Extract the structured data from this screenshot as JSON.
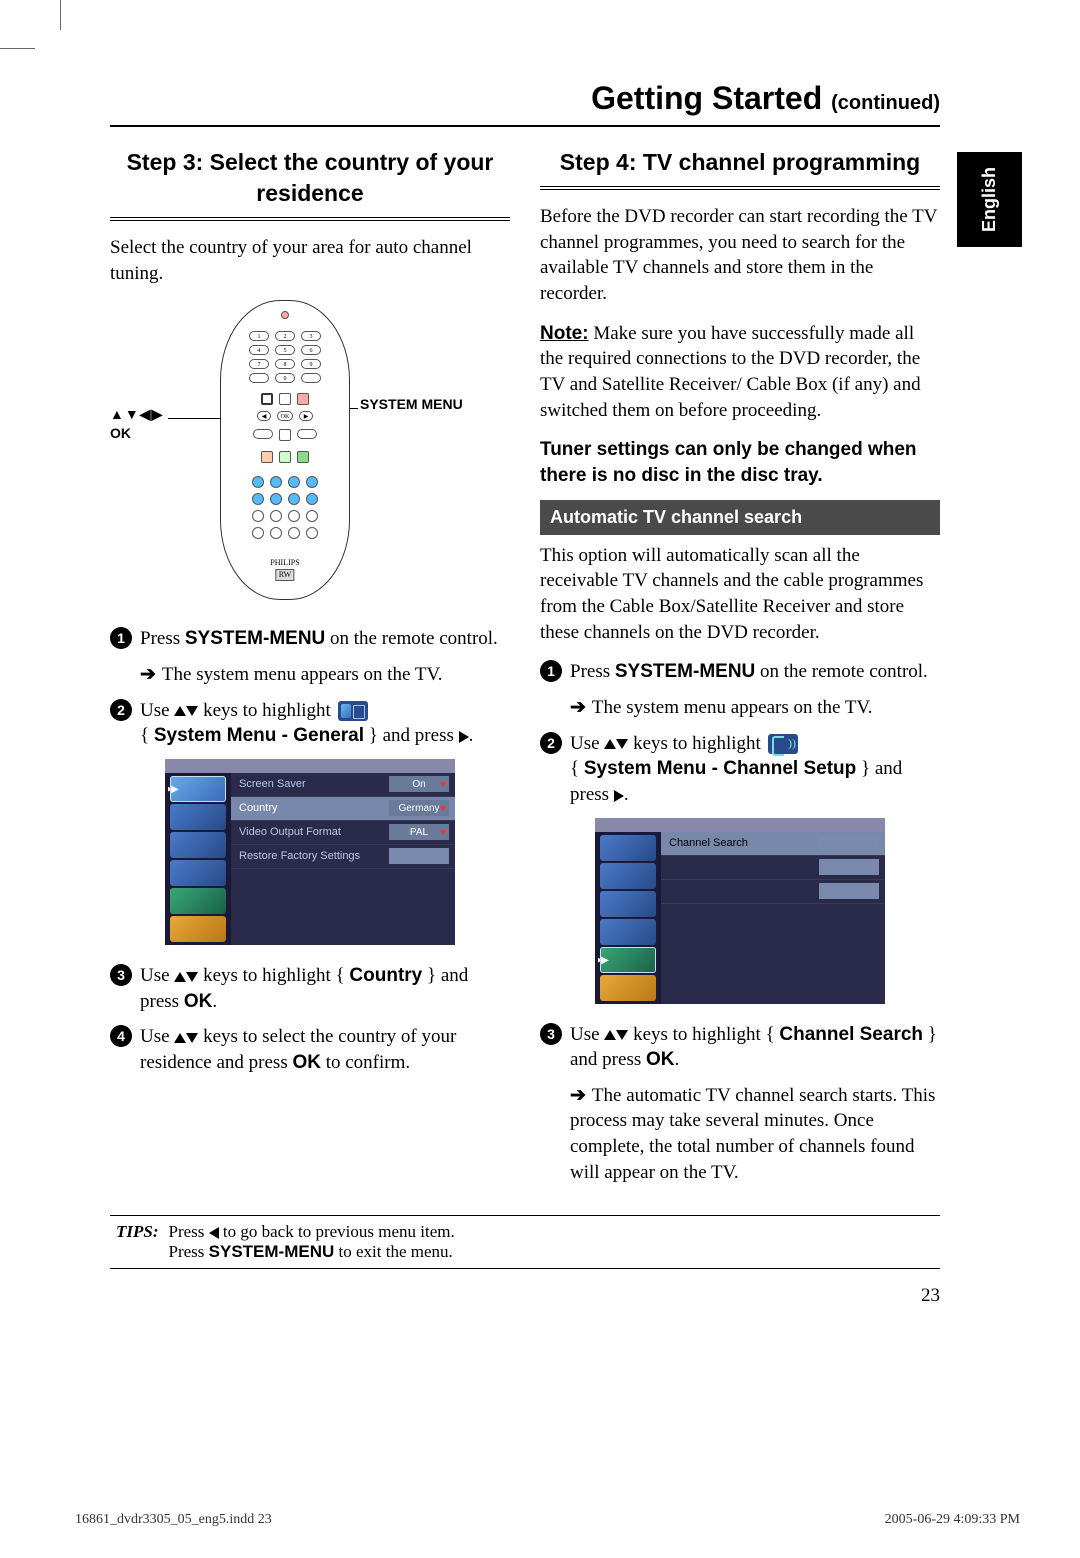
{
  "title_main": "Getting Started",
  "title_suffix": "(continued)",
  "lang_tab": "English",
  "left": {
    "step_heading": "Step 3:  Select the country of your residence",
    "intro": "Select the country of your area for auto channel tuning.",
    "remote_label_arrows": "▲▼◀▶",
    "remote_label_ok": "OK",
    "remote_label_right": "SYSTEM MENU",
    "remote_brand": "PHILIPS",
    "s1_a": "Press ",
    "s1_b": "SYSTEM-MENU",
    "s1_c": " on the remote control.",
    "s1_sub": "The system menu appears on the TV.",
    "s2_a": "Use ",
    "s2_b": " keys to highlight ",
    "s2_c": "System Menu - General",
    "s2_d": " } and press ",
    "menu": {
      "rows": [
        {
          "label": "Screen Saver",
          "val": "On"
        },
        {
          "label": "Country",
          "val": "Germany",
          "sel": true
        },
        {
          "label": "Video Output Format",
          "val": "PAL"
        },
        {
          "label": "Restore Factory Settings",
          "val": "",
          "empty": true
        }
      ]
    },
    "s3_a": "Use ",
    "s3_b": " keys to highlight { ",
    "s3_c": "Country",
    "s3_d": " } and press ",
    "s3_e": "OK",
    "s4_a": "Use ",
    "s4_b": " keys to select the country of your residence and press ",
    "s4_c": "OK",
    "s4_d": " to confirm."
  },
  "right": {
    "step_heading": "Step 4:  TV channel programming",
    "p1": "Before the DVD recorder can start recording the TV channel programmes, you need to search for the available TV channels and store them in the recorder.",
    "note_b": "Note:",
    "note_t": " Make sure you have successfully made all the required connections to the DVD recorder, the TV and Satellite Receiver/ Cable Box (if any) and switched them on before proceeding.",
    "bold_note": "Tuner settings can only be changed when there is no disc in the disc tray.",
    "section_bar": "Automatic TV channel search",
    "p2": "This option will automatically scan all the receivable TV channels and the cable programmes from the Cable Box/Satellite Receiver and store these channels on the DVD recorder.",
    "s1_a": "Press ",
    "s1_b": "SYSTEM-MENU",
    "s1_c": " on the remote control.",
    "s1_sub": "The system menu appears on the TV.",
    "s2_a": "Use ",
    "s2_b": " keys to highlight ",
    "s2_c": "System Menu - Channel Setup",
    "s2_d": " } and press ",
    "menu": {
      "rows": [
        {
          "label": "Channel Search",
          "val": "",
          "sel": true,
          "empty": true
        },
        {
          "label": "",
          "val": "",
          "empty": true
        },
        {
          "label": "",
          "val": "",
          "empty": true
        }
      ]
    },
    "s3_a": "Use ",
    "s3_b": " keys to highlight { ",
    "s3_c": "Channel Search",
    "s3_d": " } and press ",
    "s3_e": "OK",
    "s3_sub": "The automatic TV channel search starts. This process may take several minutes. Once complete, the total number of channels found will appear on the TV."
  },
  "tips_label": "TIPS:",
  "tips_line1a": "Press ",
  "tips_line1b": " to go back to previous menu item.",
  "tips_line2a": "Press ",
  "tips_line2b": "SYSTEM-MENU",
  "tips_line2c": " to exit the menu.",
  "page_num": "23",
  "footer_left": "16861_dvdr3305_05_eng5.indd   23",
  "footer_right": "2005-06-29   4:09:33 PM"
}
